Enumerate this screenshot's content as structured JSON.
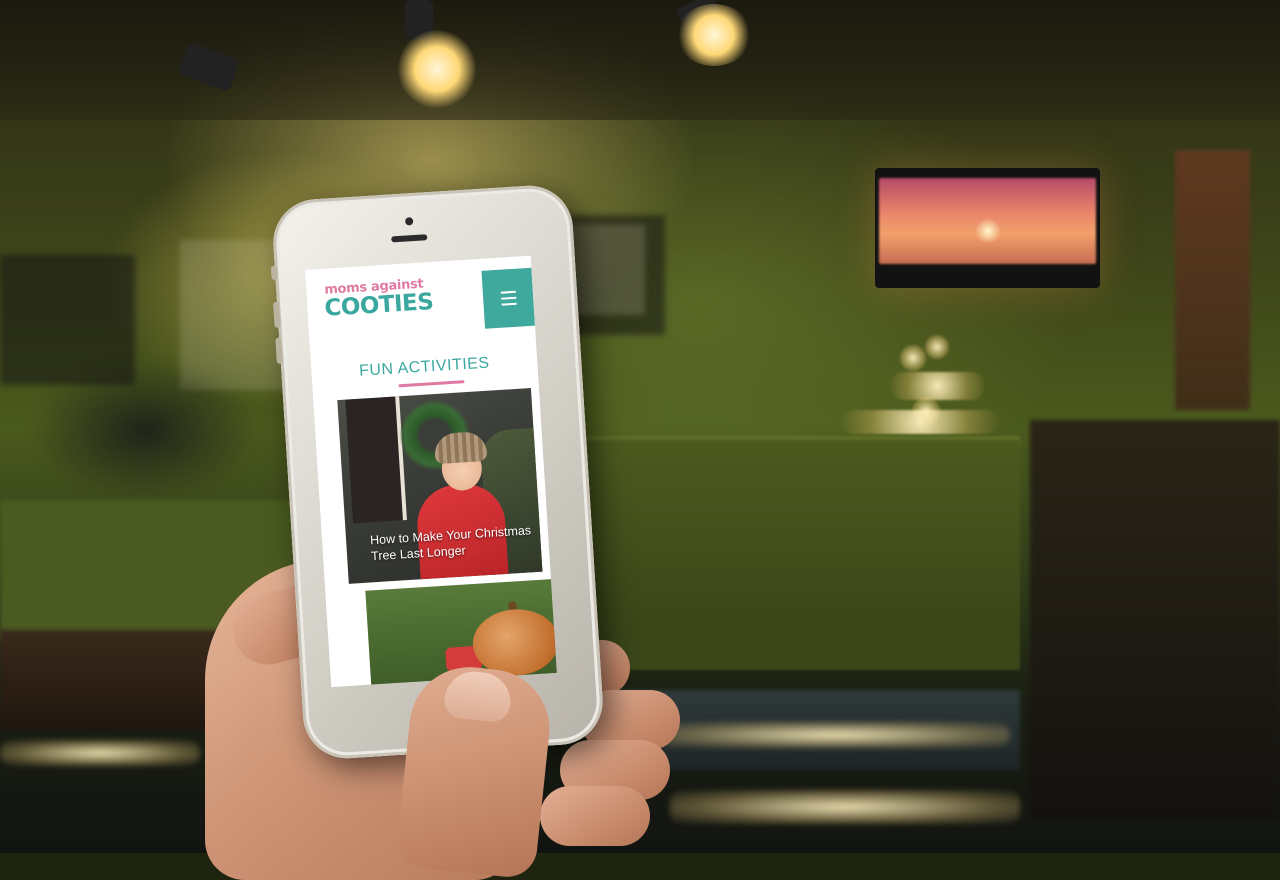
{
  "site": {
    "logo_line1": "moms against",
    "logo_line2": "COOTIES",
    "menu_icon": "hamburger-menu-icon",
    "section_title": "FUN ACTIVITIES",
    "accent_teal": "#3fa99e",
    "accent_pink": "#e07aa2",
    "cards": [
      {
        "caption": "How to Make Your Christmas Tree Last Longer"
      },
      {
        "caption": ""
      }
    ]
  }
}
